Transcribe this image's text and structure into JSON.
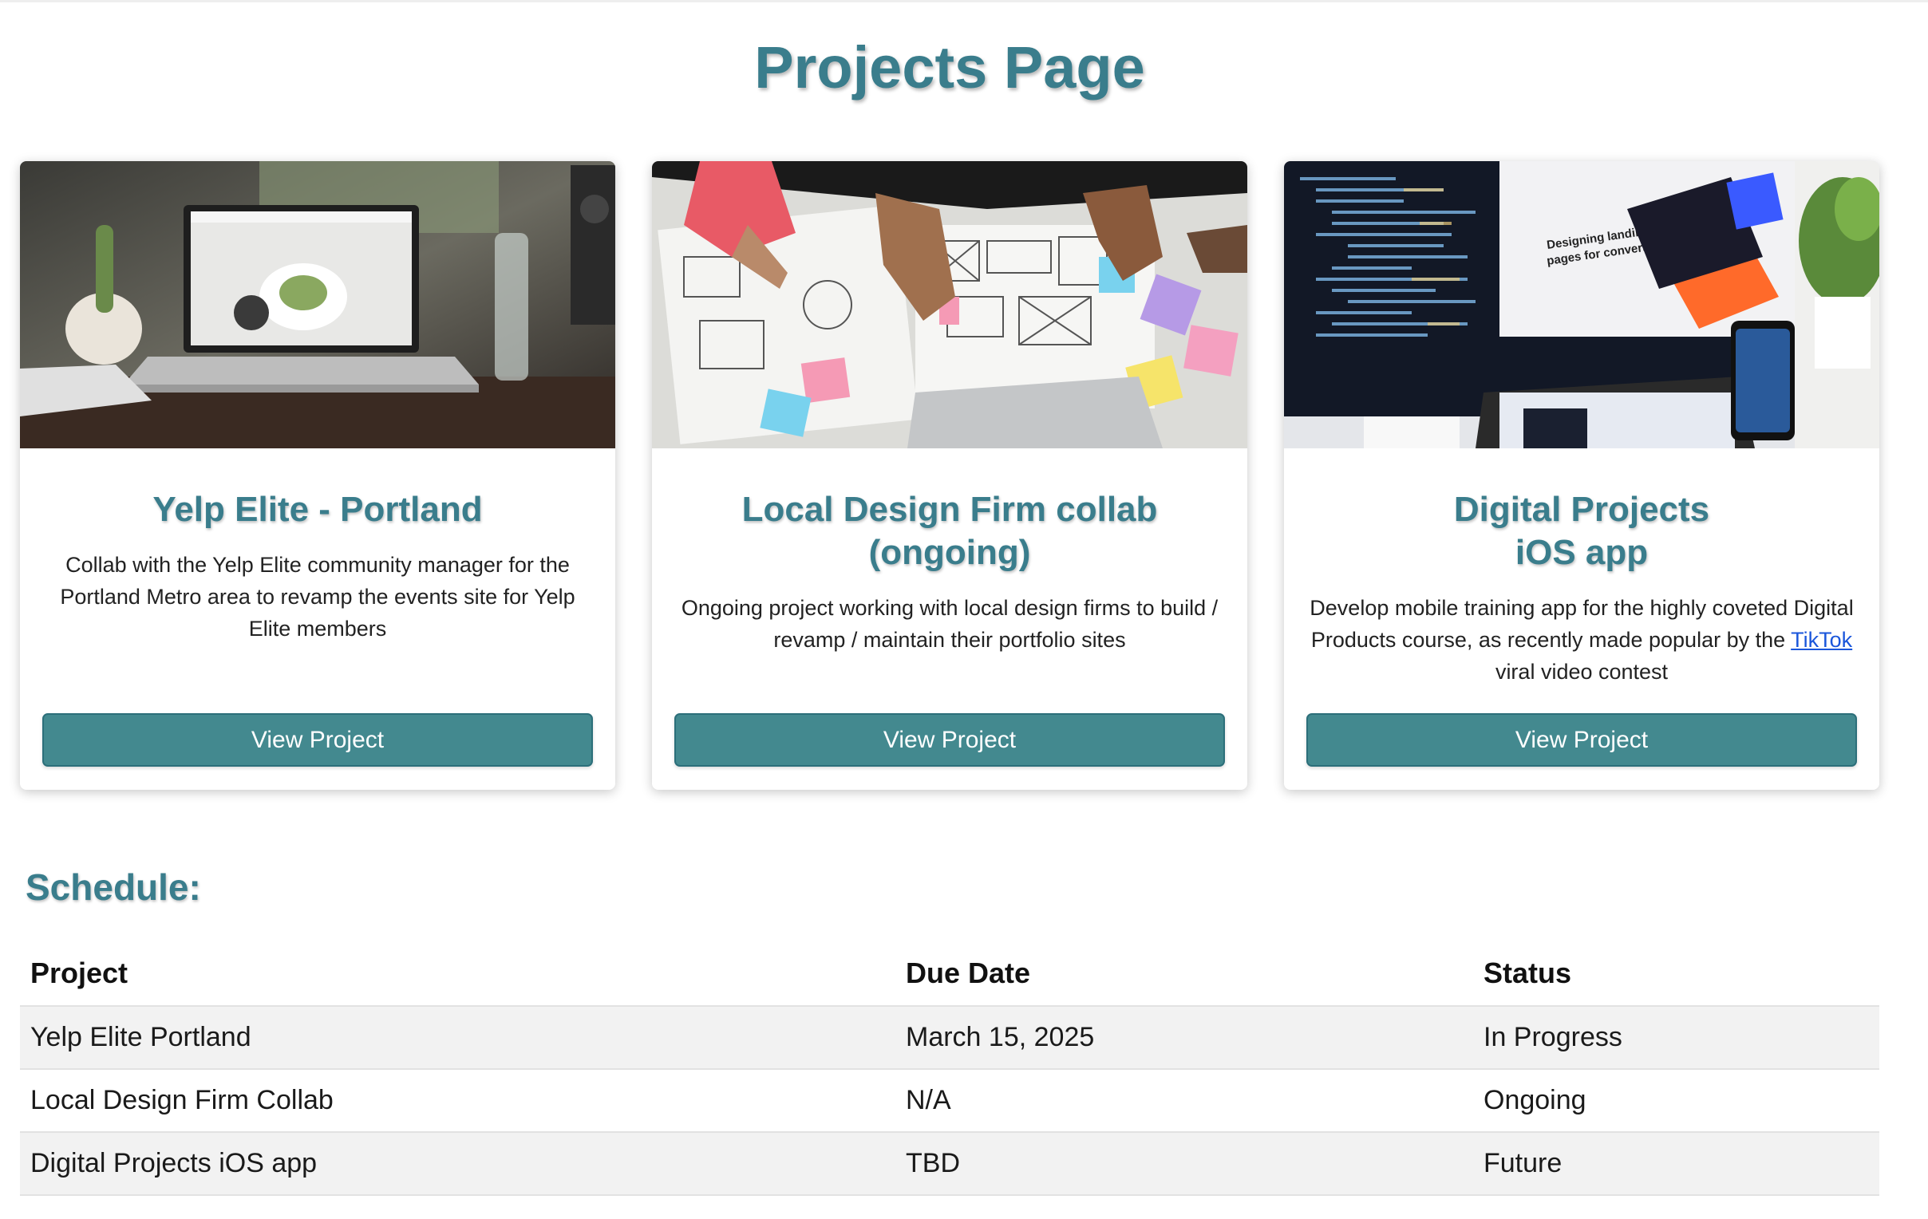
{
  "page": {
    "title": "Projects Page"
  },
  "cards": [
    {
      "image": "laptop-on-desk-photo",
      "title_line1": "Yelp Elite - Portland",
      "title_line2": "",
      "description": "Collab with the Yelp Elite community manager for the Portland Metro area to revamp the events site for Yelp Elite members",
      "button_label": "View Project"
    },
    {
      "image": "wireframe-sketching-photo",
      "title_line1": "Local Design Firm collab",
      "title_line2": "(ongoing)",
      "description": "Ongoing project working with local design firms to build / revamp / maintain their portfolio sites",
      "button_label": "View Project"
    },
    {
      "image": "monitor-code-and-ios-app-photo",
      "title_line1": "Digital Projects",
      "title_line2": "iOS app",
      "description_before": "Develop mobile training app for the highly coveted Digital Products course, as recently made popular by the ",
      "description_link": "TikTok",
      "description_after": " viral video contest",
      "button_label": "View Project"
    }
  ],
  "schedule": {
    "heading": "Schedule:",
    "columns": [
      "Project",
      "Due Date",
      "Status"
    ],
    "rows": [
      [
        "Yelp Elite Portland",
        "March 15, 2025",
        "In Progress"
      ],
      [
        "Local Design Firm Collab",
        "N/A",
        "Ongoing"
      ],
      [
        "Digital Projects iOS app",
        "TBD",
        "Future"
      ]
    ]
  },
  "colors": {
    "accent": "#3a7d8c",
    "button": "#43898f",
    "link": "#1a56db",
    "row_shade": "#f2f2f2"
  }
}
